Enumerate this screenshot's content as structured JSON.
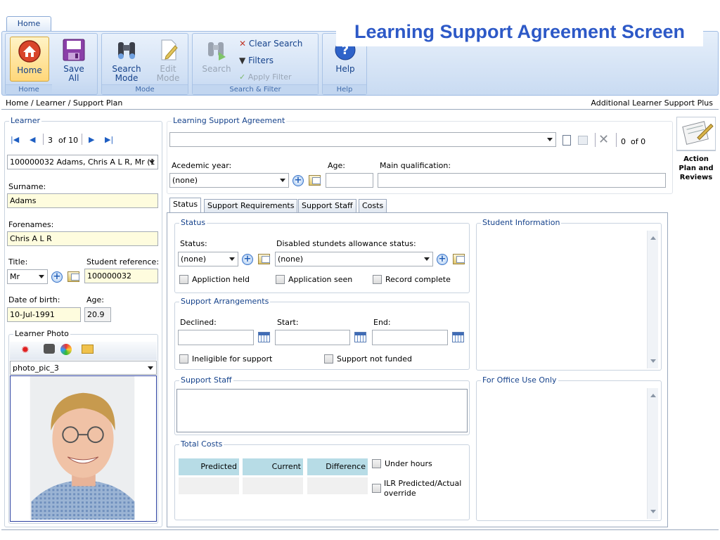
{
  "ribbon": {
    "tab": "Home",
    "groups": {
      "home": "Home",
      "mode": "Mode",
      "search_filter": "Search & Filter",
      "help": "Help"
    },
    "buttons": {
      "home": "Home",
      "save_all_line1": "Save",
      "save_all_line2": "All",
      "search_mode_line1": "Search",
      "search_mode_line2": "Mode",
      "edit_mode_line1": "Edit",
      "edit_mode_line2": "Mode",
      "search": "Search",
      "clear_search": "Clear Search",
      "filters": "Filters",
      "apply_filter": "Apply Filter",
      "help": "Help"
    }
  },
  "banner": "Learning Support Agreement Screen",
  "breadcrumb": "Home / Learner / Support Plan",
  "product": "Additional Learner Support Plus",
  "learner": {
    "legend": "Learner",
    "nav_position": "3",
    "nav_total": "of 10",
    "selected": "100000032 Adams, Chris A L R, Mr (1",
    "surname_label": "Surname:",
    "surname": "Adams",
    "forenames_label": "Forenames:",
    "forenames": "Chris A L R",
    "title_label": "Title:",
    "title": "Mr",
    "student_ref_label": "Student reference:",
    "student_ref": "100000032",
    "dob_label": "Date of birth:",
    "dob": "10-Jul-1991",
    "age_label": "Age:",
    "age": "20.9",
    "photo_legend": "Learner Photo",
    "photo_name": "photo_pic_3"
  },
  "agreement": {
    "legend": "Learning Support Agreement",
    "record_position": "0",
    "record_total": "of 0",
    "academic_year_label": "Acedemic year:",
    "academic_year": "(none)",
    "age_label": "Age:",
    "age": "",
    "main_qual_label": "Main qualification:",
    "main_qual": ""
  },
  "side_action": {
    "line1": "Action",
    "line2": "Plan and",
    "line3": "Reviews"
  },
  "tabs": [
    "Status",
    "Support Requirements",
    "Support Staff",
    "Costs"
  ],
  "status": {
    "legend": "Status",
    "status_label": "Status:",
    "status_value": "(none)",
    "dsa_label": "Disabled stundets allowance status:",
    "dsa_value": "(none)",
    "application_held": "Appliction held",
    "application_seen": "Application seen",
    "record_complete": "Record complete"
  },
  "arrangements": {
    "legend": "Support Arrangements",
    "declined_label": "Declined:",
    "start_label": "Start:",
    "end_label": "End:",
    "ineligible": "Ineligible for support",
    "not_funded": "Support not funded"
  },
  "support_staff": {
    "legend": "Support Staff"
  },
  "total_costs": {
    "legend": "Total Costs",
    "headers": [
      "Predicted",
      "Current",
      "Difference"
    ],
    "under_hours": "Under hours",
    "ilr_line1": "ILR Predicted/Actual",
    "ilr_line2": "override"
  },
  "student_info": {
    "legend": "Student Information"
  },
  "office_use": {
    "legend": "For Office Use Only"
  }
}
